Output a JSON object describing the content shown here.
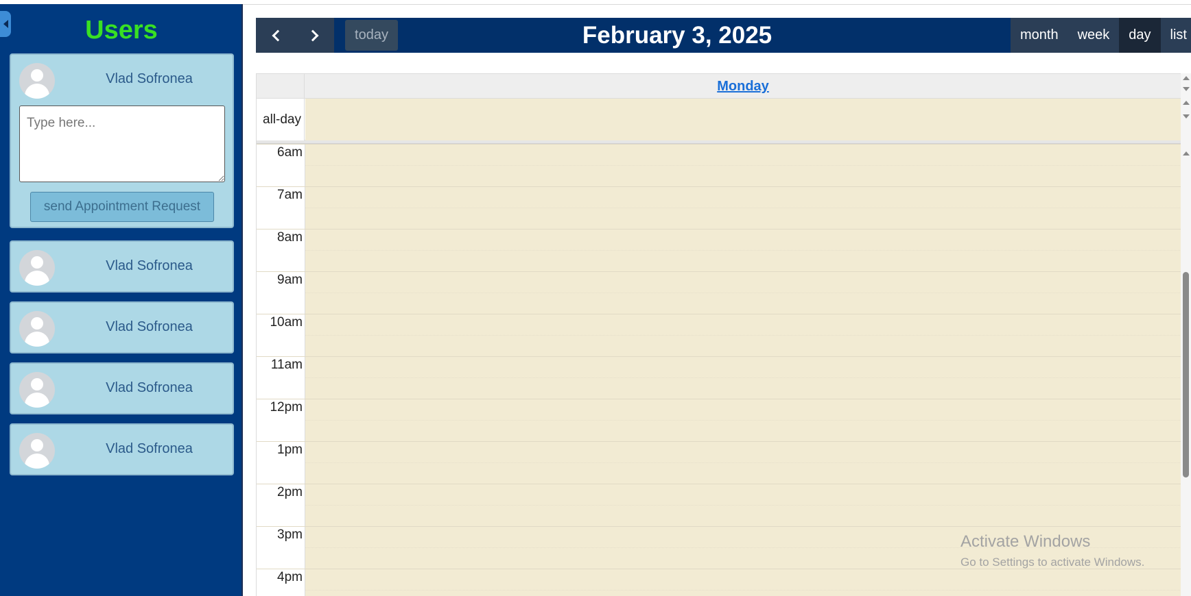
{
  "sidebar": {
    "title": "Users",
    "users": [
      {
        "name": "Vlad Sofronea",
        "expanded": true
      },
      {
        "name": "Vlad Sofronea"
      },
      {
        "name": "Vlad Sofronea"
      },
      {
        "name": "Vlad Sofronea"
      },
      {
        "name": "Vlad Sofronea"
      }
    ],
    "message_placeholder": "Type here...",
    "send_label": "send Appointment Request"
  },
  "calendar": {
    "title": "February 3, 2025",
    "today_label": "today",
    "views": [
      "month",
      "week",
      "day",
      "list"
    ],
    "active_view": "day",
    "day_name": "Monday",
    "allday_label": "all-day",
    "hours": [
      "6am",
      "7am",
      "8am",
      "9am",
      "10am",
      "11am",
      "12pm",
      "1pm",
      "2pm",
      "3pm",
      "4pm"
    ]
  },
  "watermark": {
    "title": "Activate Windows",
    "subtitle": "Go to Settings to activate Windows."
  },
  "colors": {
    "sidebar_bg": "#003a80",
    "title_green": "#39e023",
    "card_bg": "#add8e6",
    "toolbar_bg": "#02306a",
    "slot_bg": "#f2ebd3"
  }
}
